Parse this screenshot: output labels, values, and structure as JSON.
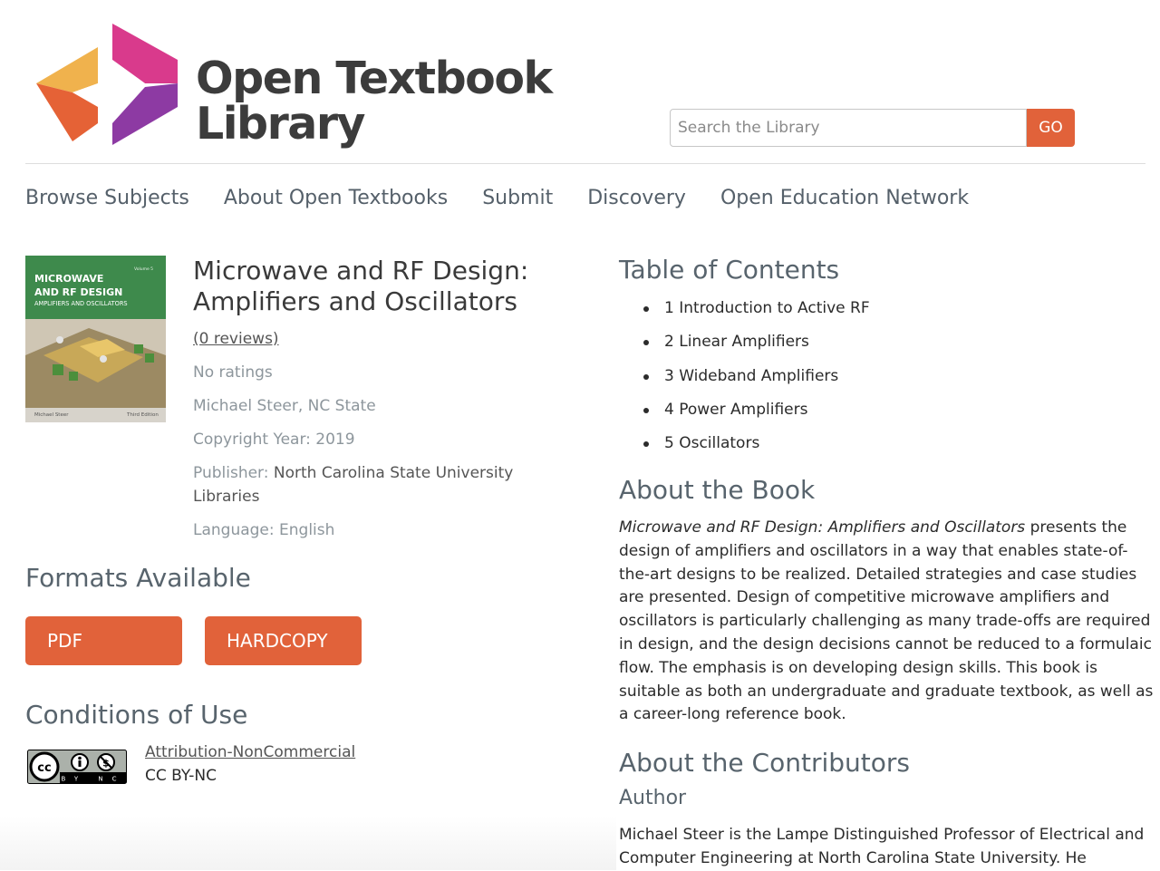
{
  "header": {
    "brand_line1": "Open Textbook",
    "brand_line2": "Library",
    "search_placeholder": "Search the Library",
    "search_button": "GO"
  },
  "nav": [
    "Browse Subjects",
    "About Open Textbooks",
    "Submit",
    "Discovery",
    "Open Education Network"
  ],
  "book": {
    "cover": {
      "line1": "MICROWAVE",
      "line2": "AND RF DESIGN",
      "line3": "AMPLIFIERS AND OSCILLATORS",
      "volume": "Volume 5",
      "author": "Michael Steer",
      "edition": "Third Edition"
    },
    "title": "Microwave and RF Design: Amplifiers and Oscillators",
    "reviews": "(0 reviews)",
    "ratings": "No ratings",
    "author_line": "Michael Steer, NC State",
    "copyright": "Copyright Year: 2019",
    "publisher_label": "Publisher: ",
    "publisher_line1": "North Carolina State University",
    "publisher_line2": "Libraries",
    "language": "Language: English"
  },
  "formats": {
    "heading": "Formats Available",
    "pdf": "PDF",
    "hardcopy": "HARDCOPY"
  },
  "conditions": {
    "heading": "Conditions of Use",
    "license_name": "Attribution-NonCommercial",
    "license_code": "CC BY-NC",
    "badge_text": "BY NC"
  },
  "toc": {
    "heading": "Table of Contents",
    "items": [
      "1 Introduction to Active RF",
      "2 Linear Amplifiers",
      "3 Wideband Amplifiers",
      "4 Power Amplifiers",
      "5 Oscillators"
    ]
  },
  "about": {
    "heading": "About the Book",
    "title_italic": "Microwave and RF Design: Amplifiers and Oscillators",
    "text": " presents the design of amplifiers and oscillators in a way that enables state-of-the-art designs to be realized. Detailed strategies and case studies are presented. Design of competitive microwave amplifiers and oscillators is particularly challenging as many trade-offs are required in design, and the design decisions cannot be reduced to a formulaic flow. The emphasis is on developing design skills. This book is suitable as both an undergraduate and graduate textbook, as well as a career-long reference book."
  },
  "contributors": {
    "heading": "About the Contributors",
    "role": "Author",
    "name": "Michael Steer",
    "bio": " is the Lampe Distinguished Professor of Electrical and Computer Engineering at North Carolina State University. He"
  },
  "colors": {
    "accent": "#e1623a",
    "heading": "#58646d",
    "muted": "#8d969c",
    "cover_green": "#3e8a4c"
  }
}
